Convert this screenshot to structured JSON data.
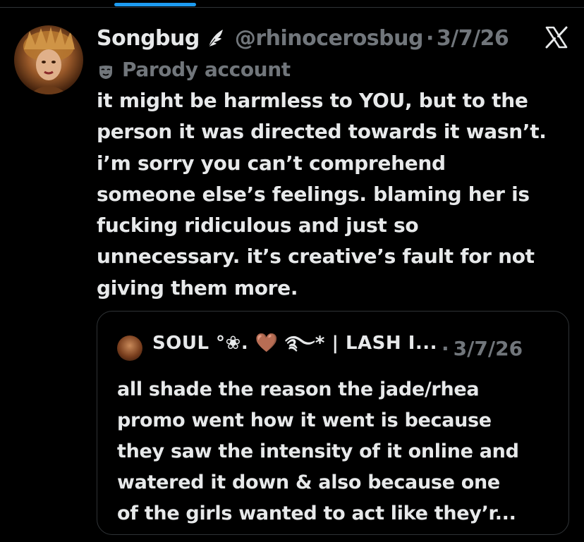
{
  "tweet": {
    "author": {
      "display_name": "Songbug",
      "handle": "@rhinocerosbug",
      "separator": "·",
      "date": "3/7/26",
      "badge_icon": "wing-icon",
      "label_icon": "mask-icon",
      "label": "Parody account"
    },
    "text_lines": [
      "it might be harmless to YOU, but to the",
      "person it was directed towards it wasn’t.",
      "i’m sorry you can’t comprehend",
      "someone else’s feelings. blaming her is",
      "fucking ridiculous and just so",
      "unnecessary. it’s creative’s fault for not",
      "giving them more."
    ],
    "platform_icon": "x-logo-icon"
  },
  "quote": {
    "author_name": "SOUL °❀. 🤎 ࿐* | LASH I...",
    "separator": "·",
    "date": "3/7/26",
    "text_lines": [
      "all shade the reason the jade/rhea",
      "promo went how it went is because",
      "they saw the intensity of it online and",
      "watered it down & also because one",
      "of the girls wanted to act like they’r..."
    ]
  },
  "colors": {
    "background": "#000000",
    "primary_text": "#e7e9ea",
    "secondary_text": "#71767b",
    "border": "#2f3336",
    "accent": "#1d9bf0"
  }
}
